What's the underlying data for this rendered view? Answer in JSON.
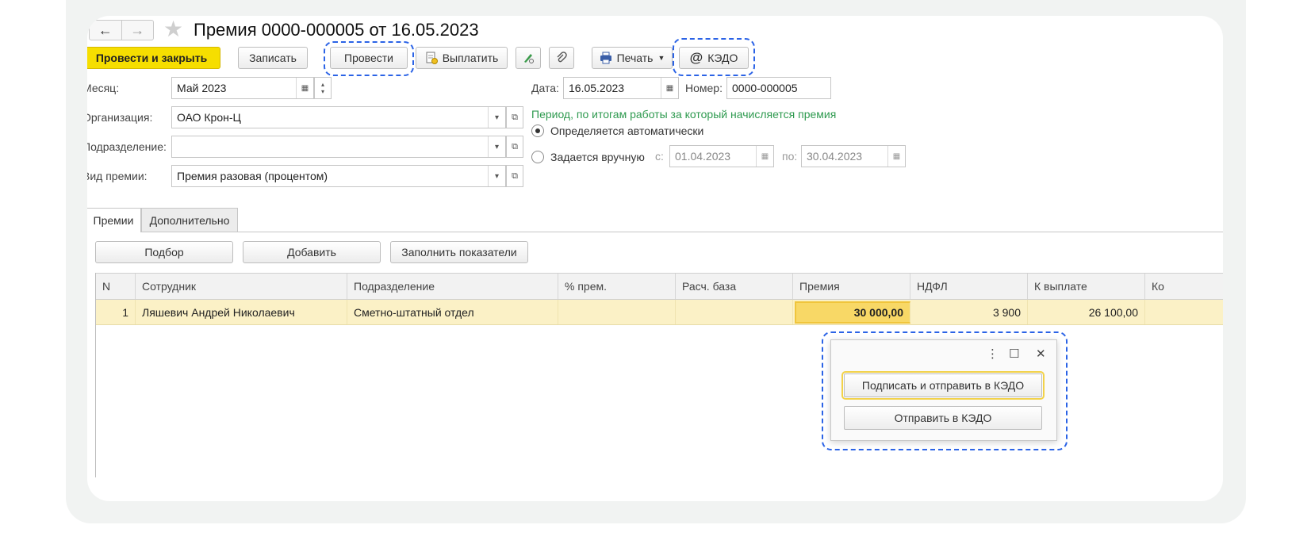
{
  "window": {
    "title": "Премия 0000-000005 от 16.05.2023",
    "back_glyph": "←",
    "forward_glyph": "→",
    "star_glyph": "★"
  },
  "toolbar": {
    "post_close_label": "Провести и закрыть",
    "save_label": "Записать",
    "post_label": "Провести",
    "pay_label": "Выплатить",
    "print_label": "Печать",
    "kedo_label": "КЭДО",
    "kedo_glyph": "@"
  },
  "form": {
    "month_label": "Месяц:",
    "month_value": "Май 2023",
    "org_label": "Организация:",
    "org_value": "ОАО Крон-Ц",
    "dept_label": "Подразделение:",
    "dept_value": "",
    "bonus_type_label": "Вид премии:",
    "bonus_type_value": "Премия разовая (процентом)",
    "date_label": "Дата:",
    "date_value": "16.05.2023",
    "number_label": "Номер:",
    "number_value": "0000-000005",
    "period_heading": "Период, по итогам работы за который начисляется премия",
    "period_auto_label": "Определяется автоматически",
    "period_manual_label": "Задается вручную",
    "period_from_label": "с:",
    "period_from_value": "01.04.2023",
    "period_to_label": "по:",
    "period_to_value": "30.04.2023"
  },
  "tabs": [
    {
      "label": "Премии",
      "active": true
    },
    {
      "label": "Дополнительно",
      "active": false
    }
  ],
  "table_toolbar": {
    "pick_label": "Подбор",
    "add_label": "Добавить",
    "fill_label": "Заполнить показатели"
  },
  "table": {
    "columns": [
      "N",
      "Сотрудник",
      "Подразделение",
      "% прем.",
      "Расч. база",
      "Премия",
      "НДФЛ",
      "К выплате",
      "Ко"
    ],
    "rows": [
      [
        "1",
        "Ляшевич Андрей Николаевич",
        "Сметно-штатный отдел",
        "",
        "",
        "30 000,00",
        "3 900",
        "26 100,00",
        ""
      ]
    ]
  },
  "popup": {
    "more_glyph": "⋮",
    "maximize_glyph": "☐",
    "close_glyph": "✕",
    "sign_send_label": "Подписать и отправить в КЭДО",
    "send_label": "Отправить в КЭДО"
  },
  "colors": {
    "highlight_dash": "#2b63e6",
    "primary_button": "#f6de00",
    "row_selected": "#fbf1c6",
    "period_heading": "#2e9a4f"
  }
}
